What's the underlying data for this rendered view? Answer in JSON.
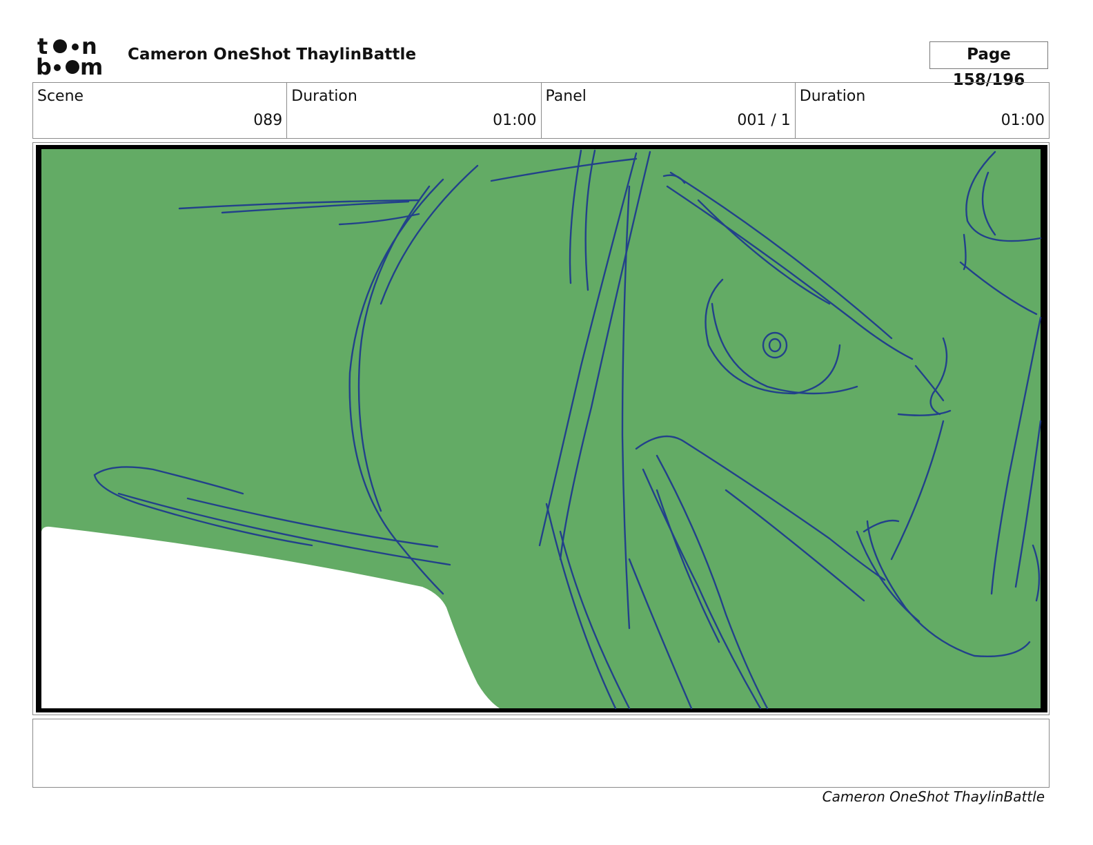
{
  "header": {
    "logo_text": "toon boom",
    "project_title": "Cameron OneShot ThaylinBattle",
    "page_indicator": "Page 158/196"
  },
  "info": {
    "scene_label": "Scene",
    "scene_value": "089",
    "scene_duration_label": "Duration",
    "scene_duration_value": "01:00",
    "panel_label": "Panel",
    "panel_value": "001 / 1",
    "panel_duration_label": "Duration",
    "panel_duration_value": "01:00"
  },
  "panel_art": {
    "background_color": "#63ab65",
    "line_color": "#1f3c8c",
    "frame_color": "#000000"
  },
  "notes": {
    "text": ""
  },
  "footer": {
    "project_title": "Cameron OneShot ThaylinBattle"
  }
}
